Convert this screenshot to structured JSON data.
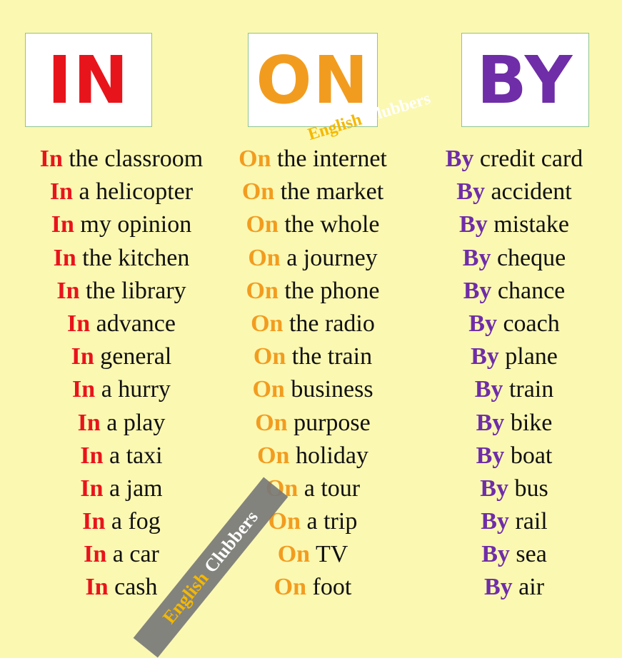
{
  "colors": {
    "in": "#e8141b",
    "on": "#f29c1f",
    "by": "#6f2da8",
    "background": "#fbf8b2"
  },
  "headers": {
    "in": "IN",
    "on": "ON",
    "by": "BY"
  },
  "watermark": {
    "word1": "English",
    "word2": "Clubbers"
  },
  "columns": {
    "in": {
      "keyword": "In",
      "phrases": [
        "the classroom",
        "a helicopter",
        "my opinion",
        "the kitchen",
        "the library",
        "advance",
        "general",
        "a hurry",
        "a play",
        "a taxi",
        "a jam",
        "a fog",
        "a car",
        "cash"
      ]
    },
    "on": {
      "keyword": "On",
      "phrases": [
        "the internet",
        "the market",
        "the whole",
        "a journey",
        "the phone",
        "the radio",
        "the train",
        "business",
        "purpose",
        "holiday",
        "a tour",
        "a trip",
        "TV",
        "foot"
      ]
    },
    "by": {
      "keyword": "By",
      "phrases": [
        "credit card",
        "accident",
        "mistake",
        "cheque",
        "chance",
        "coach",
        "plane",
        "train",
        "bike",
        "boat",
        "bus",
        "rail",
        "sea",
        "air"
      ]
    }
  }
}
